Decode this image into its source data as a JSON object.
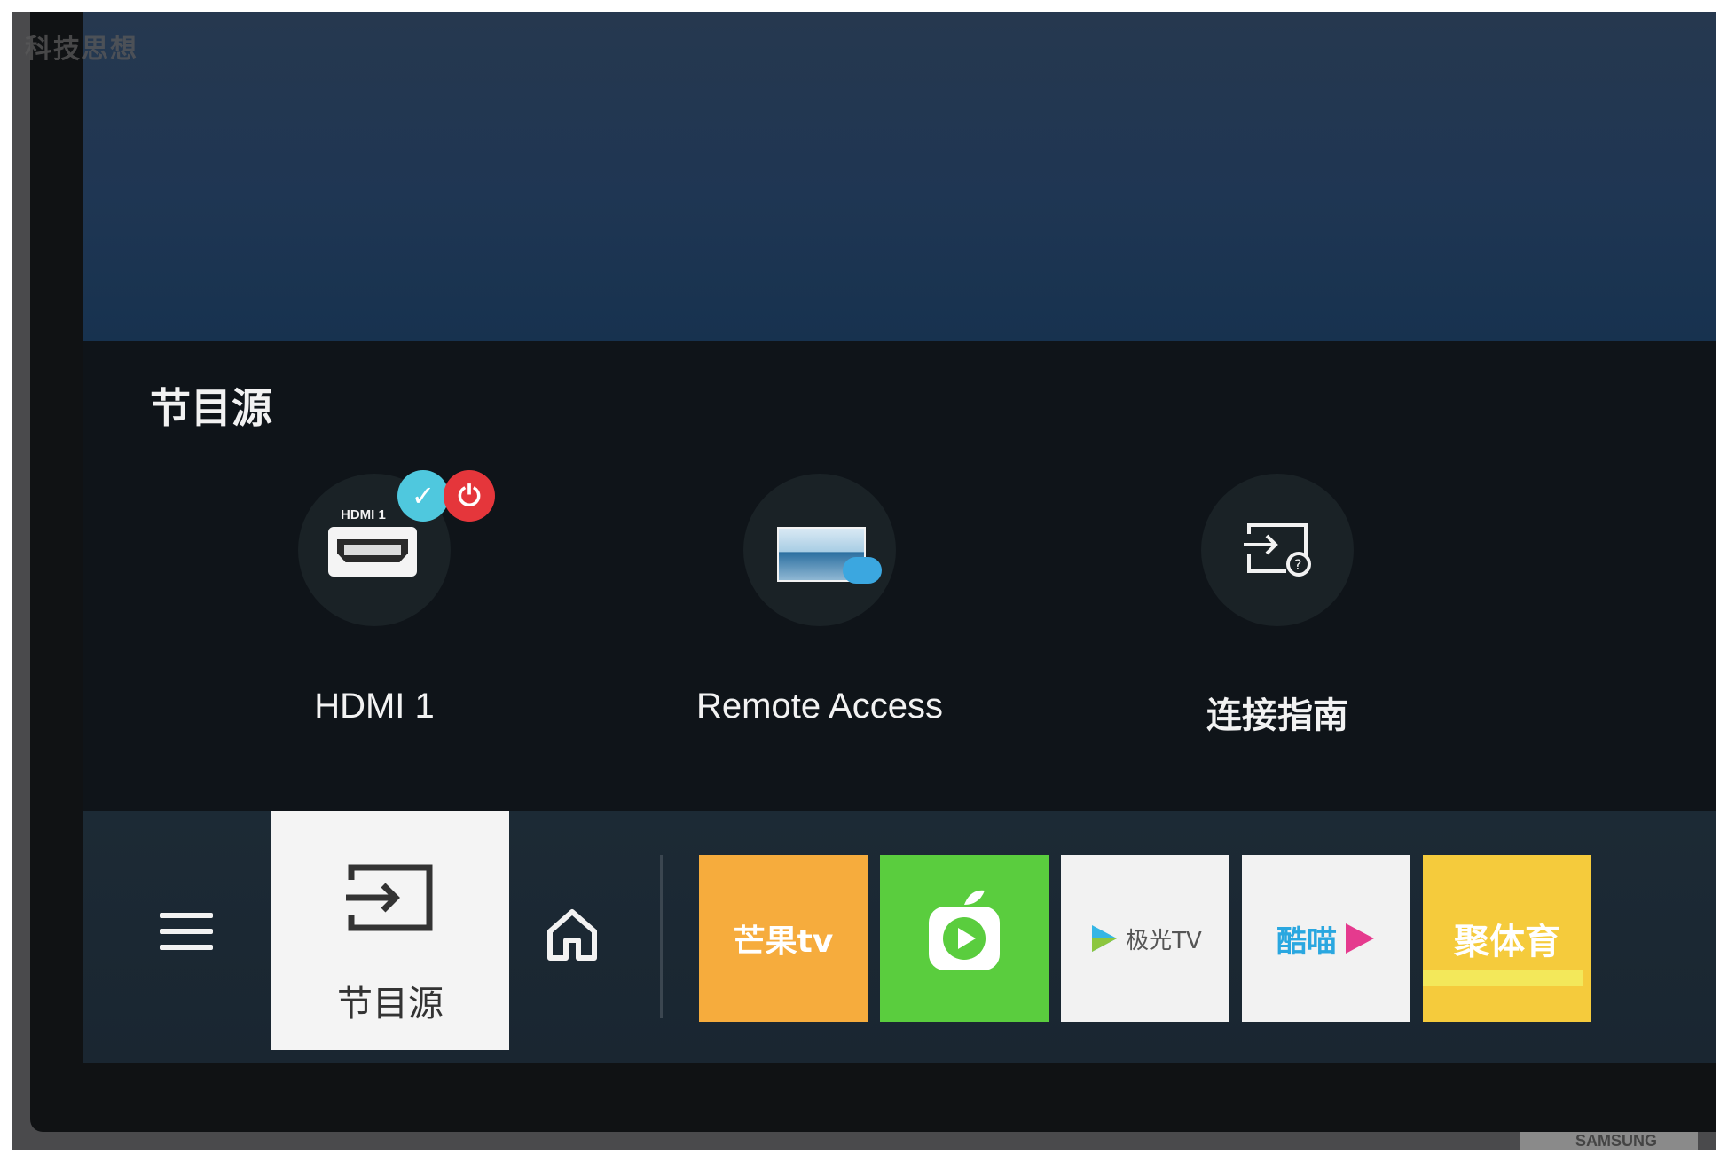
{
  "watermark": "科技思想",
  "source_panel": {
    "title": "节目源",
    "items": [
      {
        "label": "HDMI 1",
        "badge_text": "HDMI 1",
        "icon": "hdmi-port-icon",
        "status_icons": [
          "check-icon",
          "power-icon"
        ]
      },
      {
        "label": "Remote Access",
        "icon": "remote-access-icon"
      },
      {
        "label": "连接指南",
        "icon": "connection-guide-icon"
      }
    ]
  },
  "taskbar": {
    "menu_icon": "hamburger-menu-icon",
    "selected_source": {
      "label": "节目源",
      "icon": "source-input-icon"
    },
    "home_icon": "home-icon",
    "apps": [
      {
        "name": "芒果tv",
        "color": "#f6ac3d"
      },
      {
        "name": "",
        "icon": "green-tv-app-icon",
        "color": "#5acd3e"
      },
      {
        "name": "极光TV",
        "color": "#f2f2f2"
      },
      {
        "name": "酷喵",
        "color": "#f2f2f2"
      },
      {
        "name": "聚体育",
        "color": "#f5cb3c"
      }
    ]
  },
  "brand": "SAMSUNG",
  "colors": {
    "sky_top": "#26384f",
    "panel_bg": "#0f1419",
    "taskbar_bg": "#1c2a35",
    "check_badge": "#4fc8de",
    "power_badge": "#e5363b"
  }
}
